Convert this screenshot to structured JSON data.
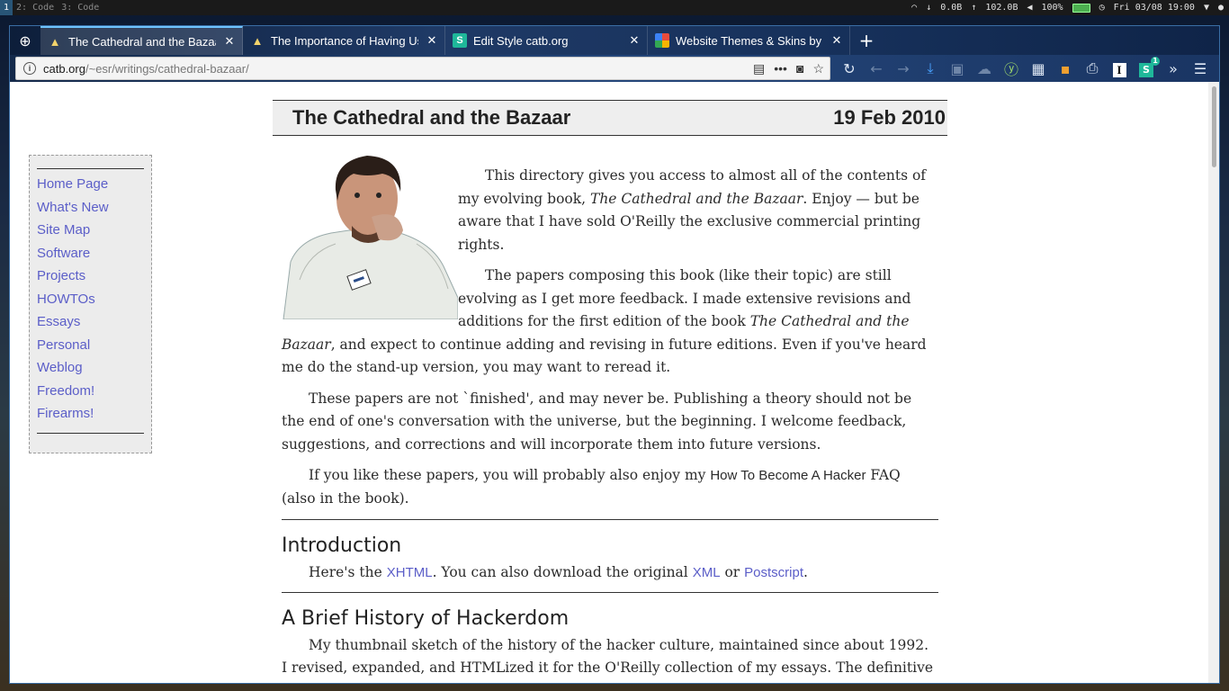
{
  "wm": {
    "workspaces": [
      {
        "label": "1",
        "active": true
      },
      {
        "label": "2: Code",
        "active": false
      },
      {
        "label": "3: Code",
        "active": false
      }
    ],
    "net_down": "0.0B",
    "net_up": "102.0B",
    "volume": "100%",
    "clock": "Fri 03/08 19:00"
  },
  "browser": {
    "tabs": [
      {
        "title": "The Cathedral and the Bazaar",
        "favicon": "cathedral-icon",
        "active": true
      },
      {
        "title": "The Importance of Having Users",
        "favicon": "cathedral-icon",
        "active": false
      },
      {
        "title": "Edit Style catb.org",
        "favicon": "stylus-icon",
        "active": false
      },
      {
        "title": "Website Themes & Skins by",
        "favicon": "themes-icon",
        "active": false
      }
    ],
    "url_domain": "catb.org",
    "url_path": "/~esr/writings/cathedral-bazaar/",
    "toolbar_badge": "1"
  },
  "page": {
    "header_title": "The Cathedral and the Bazaar",
    "header_date": "19 Feb 2010",
    "sidebar": [
      "Home Page",
      "What's New",
      "Site Map",
      "Software",
      "Projects",
      "HOWTOs",
      "Essays",
      "Personal",
      "Weblog",
      "Freedom!",
      "Firearms!"
    ],
    "p1_a": "This directory gives you access to almost all of the contents of my evolving book, ",
    "p1_em": "The Cathedral and the Bazaar",
    "p1_b": ". Enjoy — but be aware that I have sold O'Reilly the exclusive commercial printing rights.",
    "p2_a": "The papers composing this book (like their topic) are still evolving as I get more feedback. I made extensive revisions and additions for the first edition of the book ",
    "p2_em": "The Cathedral and the Bazaar",
    "p2_b": ", and expect to continue adding and revising in future editions. Even if you've heard me do the stand-up version, you may want to reread it.",
    "p3": "These papers are not `finished', and may never be. Publishing a theory should not be the end of one's conversation with the universe, but the beginning. I welcome feedback, suggestions, and corrections and will incorporate them into future versions.",
    "p4_a": "If you like these papers, you will probably also enjoy my ",
    "p4_link": "How To Become A Hacker",
    "p4_b": " FAQ (also in the book).",
    "intro_title": "Introduction",
    "intro_a": "Here's the ",
    "intro_xhtml": "XHTML",
    "intro_b": ". You can also download the original ",
    "intro_xml": "XML",
    "intro_or": " or ",
    "intro_ps": "Postscript",
    "intro_end": ".",
    "history_title": "A Brief History of Hackerdom",
    "history_text": "My thumbnail sketch of the history of the hacker culture, maintained since about 1992. I revised, expanded, and HTMLized it for the O'Reilly collection of my essays. The definitive history of the hacker culture remains to be written, probably not by me."
  }
}
